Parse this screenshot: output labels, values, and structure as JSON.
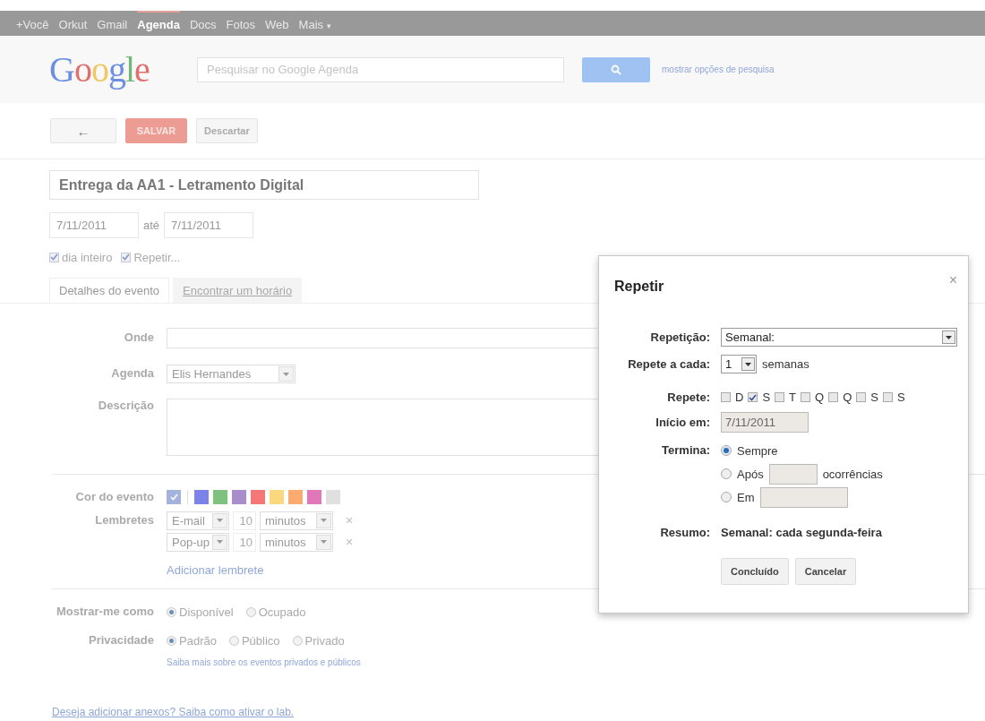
{
  "top_bar": {
    "items": [
      {
        "label": "+Você",
        "selected": false
      },
      {
        "label": "Orkut",
        "selected": false
      },
      {
        "label": "Gmail",
        "selected": false
      },
      {
        "label": "Agenda",
        "selected": true
      },
      {
        "label": "Docs",
        "selected": false
      },
      {
        "label": "Fotos",
        "selected": false
      },
      {
        "label": "Web",
        "selected": false
      },
      {
        "label": "Mais",
        "selected": false,
        "caret": "▾"
      }
    ]
  },
  "header": {
    "logo": "Google",
    "search": {
      "placeholder": "Pesquisar no Google Agenda"
    },
    "search_options": "mostrar opções de pesquisa"
  },
  "toolbar": {
    "back": "←",
    "save": "SALVAR",
    "discard": "Descartar"
  },
  "event": {
    "title": "Entrega da AA1 - Letramento Digital",
    "start_date": "7/11/2011",
    "until": "até",
    "end_date": "7/11/2011",
    "options": [
      {
        "label": "dia inteiro",
        "checked": true
      },
      {
        "label": "Repetir...",
        "checked": true
      }
    ]
  },
  "tabs": [
    {
      "label": "Detalhes do evento",
      "selected": true
    },
    {
      "label": "Encontrar um horário",
      "selected": false
    }
  ],
  "details": {
    "where_label": "Onde",
    "calendar_label": "Agenda",
    "calendar": "Elis Hernandes",
    "description_label": "Descrição",
    "color_label": "Cor do evento",
    "colors": [
      {
        "color": "#a4b3dc",
        "selected": true
      },
      {
        "color": "#7b83e8",
        "selected": false
      },
      {
        "color": "#7fc27f",
        "selected": false
      },
      {
        "color": "#a98ecd",
        "selected": false
      },
      {
        "color": "#f47878",
        "selected": false
      },
      {
        "color": "#fbd87e",
        "selected": false
      },
      {
        "color": "#fbab70",
        "selected": false
      },
      {
        "color": "#e177b8",
        "selected": false
      },
      {
        "color": "#e0e0e0",
        "selected": false
      }
    ],
    "reminders_label": "Lembretes",
    "reminders": [
      {
        "method": "E-mail",
        "amount": "10",
        "unit": "minutos",
        "remove": "×"
      },
      {
        "method": "Pop-up",
        "amount": "10",
        "unit": "minutos",
        "remove": "×"
      }
    ],
    "add_reminder": "Adicionar lembrete",
    "show_as_label": "Mostrar-me como",
    "show_as": [
      {
        "label": "Disponível",
        "selected": true
      },
      {
        "label": "Ocupado",
        "selected": false
      }
    ],
    "privacy_label": "Privacidade",
    "privacy": [
      {
        "label": "Padrão",
        "selected": true
      },
      {
        "label": "Público",
        "selected": false
      },
      {
        "label": "Privado",
        "selected": false
      }
    ],
    "privacy_link": "Saiba mais sobre os eventos privados e públicos"
  },
  "attachments_link": "Deseja adicionar anexos? Saiba como ativar o lab.",
  "dialog": {
    "title": "Repetir",
    "close": "×",
    "repeat_label": "Repetição:",
    "repeat": "Semanal:",
    "every_label": "Repete a cada:",
    "every": "1",
    "every_unit": "semanas",
    "days_label": "Repete:",
    "days": [
      {
        "label": "D",
        "checked": false
      },
      {
        "label": "S",
        "checked": true
      },
      {
        "label": "T",
        "checked": false
      },
      {
        "label": "Q",
        "checked": false
      },
      {
        "label": "Q",
        "checked": false
      },
      {
        "label": "S",
        "checked": false
      },
      {
        "label": "S",
        "checked": false
      }
    ],
    "start_label": "Início em:",
    "start": "7/11/2011",
    "ends_label": "Termina:",
    "ends": [
      {
        "kind": "plain",
        "label": "Sempre",
        "selected": true
      },
      {
        "kind": "count",
        "label": "Após",
        "suffix": "ocorrências",
        "selected": false
      },
      {
        "kind": "date",
        "label": "Em",
        "selected": false
      }
    ],
    "summary_label": "Resumo:",
    "summary": "Semanal: cada segunda-feira",
    "buttons": [
      "Concluído",
      "Cancelar"
    ]
  }
}
